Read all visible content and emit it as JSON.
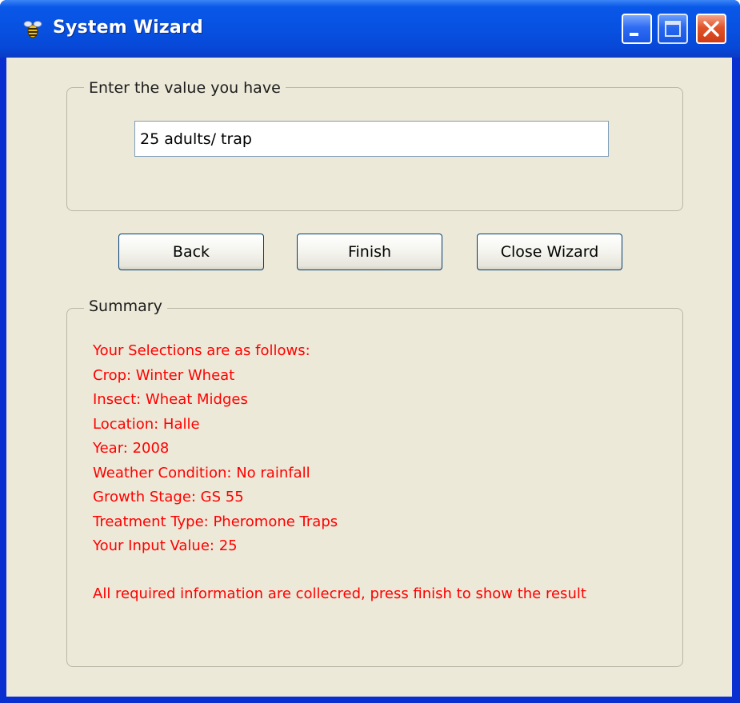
{
  "window": {
    "title": "System Wizard",
    "icon": "bee-icon",
    "controls": [
      "minimize-icon",
      "maximize-icon",
      "close-icon"
    ]
  },
  "input_group": {
    "legend": "Enter the value you have",
    "value_input": {
      "value": "25 adults/ trap",
      "placeholder": ""
    }
  },
  "buttons": {
    "back_label": "Back",
    "finish_label": "Finish",
    "close_wizard_label": "Close Wizard"
  },
  "summary": {
    "legend": "Summary",
    "lines": [
      "Your Selections are as follows:",
      "Crop: Winter Wheat",
      "Insect: Wheat Midges",
      "Location: Halle",
      "Year: 2008",
      "Weather Condition: No rainfall",
      "Growth Stage: GS 55",
      "Treatment Type: Pheromone Traps",
      "Your Input Value: 25"
    ],
    "note": "All required information are collecred, press finish to show the result",
    "text_color": "#ff0000"
  },
  "colors": {
    "titlebar": "#0750e0",
    "client_background": "#ece9d8",
    "close_button": "#e0542a"
  }
}
